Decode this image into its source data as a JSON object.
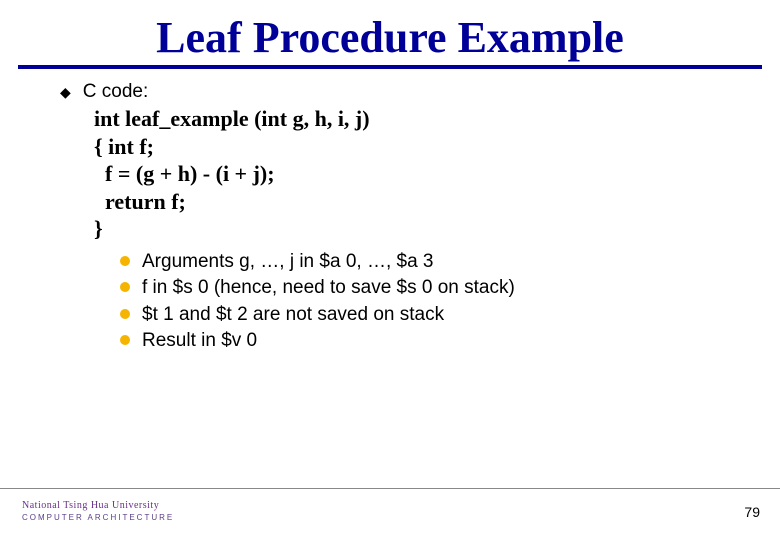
{
  "title": "Leaf Procedure Example",
  "heading": "C code:",
  "code": "int leaf_example (int g, h, i, j)\n{ int f;\n  f = (g + h) - (i + j);\n  return f;\n}",
  "bullets": [
    "Arguments g, …, j in $a 0, …, $a 3",
    "f in $s 0 (hence, need to save $s 0 on stack)",
    "$t 1 and $t 2 are not saved on stack",
    "Result in $v 0"
  ],
  "footer": {
    "university": "National Tsing Hua University",
    "dept": "COMPUTER ARCHITECTURE",
    "page": "79"
  }
}
